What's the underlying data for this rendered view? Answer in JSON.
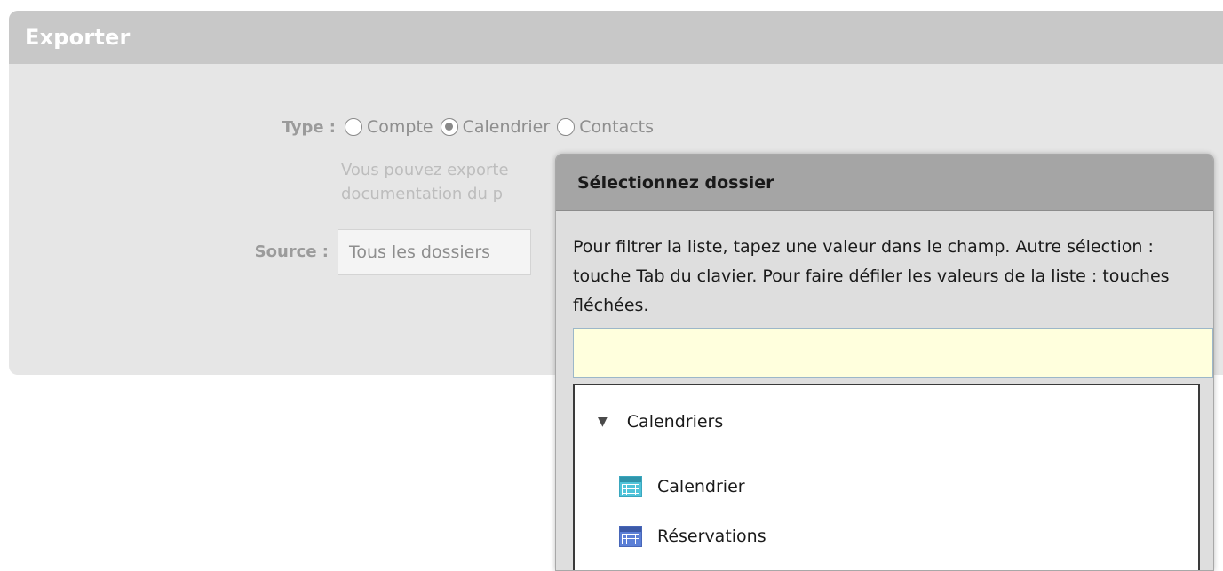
{
  "panel": {
    "title": "Exporter",
    "type_label": "Type :",
    "type_options": [
      {
        "label": "Compte",
        "checked": false
      },
      {
        "label": "Calendrier",
        "checked": true
      },
      {
        "label": "Contacts",
        "checked": false
      }
    ],
    "help_line1": "Vous pouvez exporte",
    "help_line2": "documentation du p",
    "source_label": "Source :",
    "source_value": "Tous les dossiers"
  },
  "dialog": {
    "title": "Sélectionnez dossier",
    "instructions": "Pour filtrer la liste, tapez une valeur dans le champ. Autre sélection : touche Tab du clavier. Pour faire défiler les valeurs de la liste : touches fléchées.",
    "filter_value": "",
    "tree": {
      "root_label": "Calendriers",
      "expand_glyph": "▼",
      "items": [
        {
          "label": "Calendrier",
          "icon": "calendar-icon",
          "color": "#4fc3d9"
        },
        {
          "label": "Réservations",
          "icon": "calendar-icon",
          "color": "#5b7fd6"
        }
      ]
    }
  },
  "colors": {
    "panel_bg": "#e6e6e6",
    "panel_header": "#c8c8c8",
    "dialog_header": "#a5a5a5",
    "filter_bg": "#ffffdd"
  }
}
